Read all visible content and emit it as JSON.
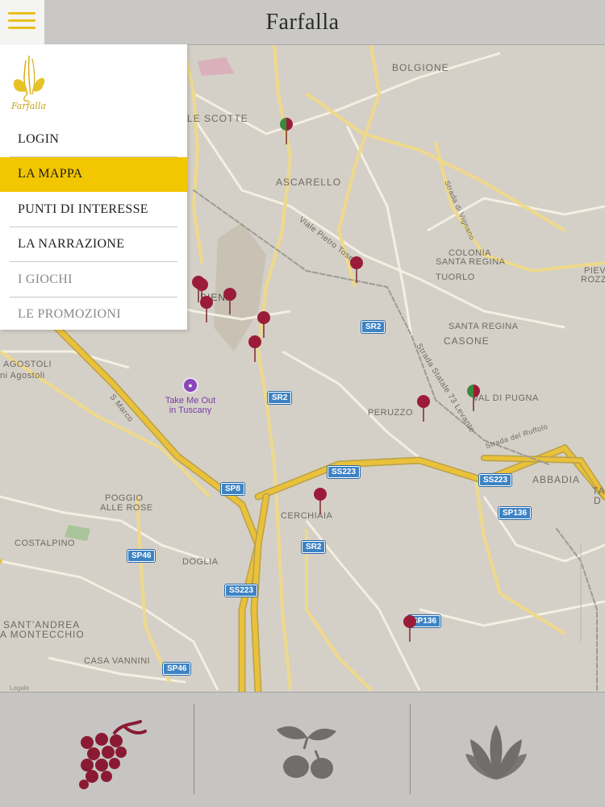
{
  "app": {
    "title": "Farfalla"
  },
  "menu": {
    "logo_text": "Farfalla",
    "items": [
      {
        "label": "LOGIN",
        "state": "normal"
      },
      {
        "label": "LA MAPPA",
        "state": "active"
      },
      {
        "label": "PUNTI DI INTERESSE",
        "state": "normal"
      },
      {
        "label": "LA NARRAZIONE",
        "state": "normal"
      },
      {
        "label": "I GIOCHI",
        "state": "muted"
      },
      {
        "label": "LE PROMOZIONI",
        "state": "muted"
      }
    ],
    "active_color": "#f2c600"
  },
  "map": {
    "places": [
      "BOLGIONE",
      "LE SCOTTE",
      "ASCARELLO",
      "COLONIA",
      "SANTA REGINA",
      "TUORLO",
      "PIEV",
      "ROZZ",
      "SANTA REGINA",
      "CASONE",
      "VAL DI PUGNA",
      "PERUZZO",
      "ABBADIA",
      "TA",
      "D",
      "POGGIO",
      "ALLE ROSE",
      "CERCHIAIA",
      "COSTALPINO",
      "DOGLIA",
      "SANT'ANDREA",
      "A MONTECCHIO",
      "CASA VANNINI",
      "AGOSTOLI",
      "ni Agostoli",
      "SIENA"
    ],
    "streets": [
      "Viale Pietro Toselli",
      "Strada di Vignano",
      "Strada Statale 73 Levante",
      "Strada del Ruffolo",
      "S Marco"
    ],
    "road_shields": [
      "SR2",
      "SR2",
      "SP8",
      "SS223",
      "SS223",
      "SP136",
      "SP46",
      "SR2",
      "SS223",
      "SP136",
      "SP46"
    ],
    "poi": {
      "name_line1": "Take Me Out",
      "name_line2": "in Tuscany"
    },
    "legal": "Legale",
    "pin_color": "#9b1c3a",
    "pin_alt_color": "#3a8a3a"
  },
  "tabs": [
    {
      "name": "grapes-icon",
      "color": "#8a1a33"
    },
    {
      "name": "olive-icon",
      "color": "#6f6e6c"
    },
    {
      "name": "lotus-icon",
      "color": "#6f6e6c"
    }
  ]
}
